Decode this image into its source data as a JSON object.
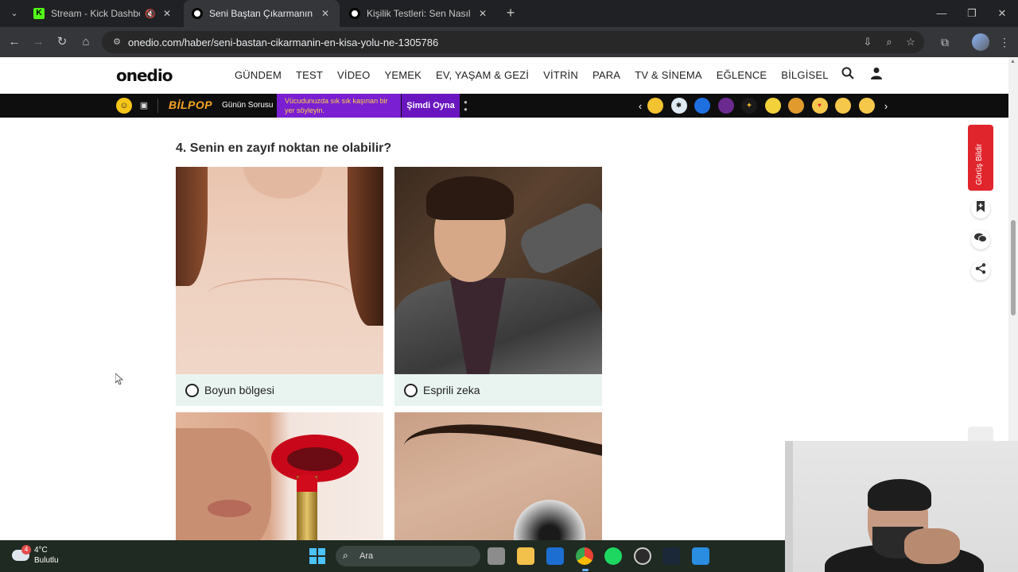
{
  "browser": {
    "tabs": [
      {
        "title": "Stream - Kick Dashboard",
        "active": false
      },
      {
        "title": "Seni Baştan Çıkarmanın En Kısa",
        "active": true
      },
      {
        "title": "Kişilik Testleri: Sen Nasıl Birisin?",
        "active": false
      }
    ],
    "url": "onedio.com/haber/seni-bastan-cikarmanin-en-kisa-yolu-ne-1305786"
  },
  "site": {
    "logo": "onedio",
    "nav": [
      "GÜNDEM",
      "TEST",
      "VİDEO",
      "YEMEK",
      "EV, YAŞAM & GEZİ",
      "VİTRİN",
      "PARA",
      "TV & SİNEMA",
      "EĞLENCE",
      "BİLGİSEL"
    ]
  },
  "bilpop": {
    "logo": "BİLPOP",
    "daily_label": "Günün Sorusu",
    "question": "Vücudunuzda sık sık kaşınan bir yer söyleyin.",
    "play_button": "Şimdi Oyna"
  },
  "question": {
    "title": "4. Senin en zayıf noktan ne olabilir?",
    "options": [
      {
        "label": "Boyun bölgesi",
        "selected": false
      },
      {
        "label": "Esprili zeka",
        "selected": false
      }
    ]
  },
  "sidebar": {
    "feedback": "Görüş Bildir"
  },
  "taskbar": {
    "weather_temp": "4°C",
    "weather_desc": "Bulutlu",
    "weather_badge": "4",
    "search_placeholder": "Ara"
  },
  "colors": {
    "accent_red": "#e1252d",
    "bilpop_purple": "#7a1fd1",
    "option_bg": "#e9f4f1"
  }
}
